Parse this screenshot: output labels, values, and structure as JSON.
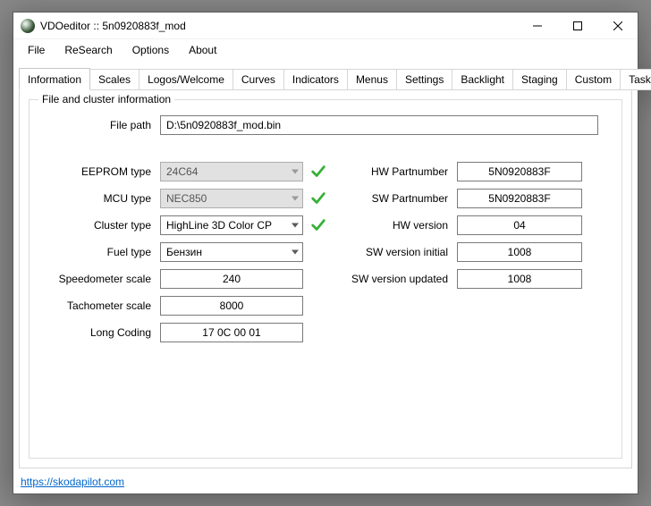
{
  "window": {
    "title": "VDOeditor :: 5n0920883f_mod"
  },
  "menu": {
    "file": "File",
    "research": "ReSearch",
    "options": "Options",
    "about": "About"
  },
  "tabs": {
    "information": "Information",
    "scales": "Scales",
    "logos": "Logos/Welcome",
    "curves": "Curves",
    "indicators": "Indicators",
    "menus": "Menus",
    "settings": "Settings",
    "backlight": "Backlight",
    "staging": "Staging",
    "custom": "Custom",
    "tasks": "Tasks"
  },
  "fieldset_legend": "File and cluster information",
  "labels": {
    "file_path": "File path",
    "eeprom_type": "EEPROM type",
    "mcu_type": "MCU type",
    "cluster_type": "Cluster type",
    "fuel_type": "Fuel type",
    "speedometer_scale": "Speedometer scale",
    "tachometer_scale": "Tachometer scale",
    "long_coding": "Long Coding",
    "hw_partnumber": "HW Partnumber",
    "sw_partnumber": "SW Partnumber",
    "hw_version": "HW version",
    "sw_version_initial": "SW version initial",
    "sw_version_updated": "SW version updated"
  },
  "values": {
    "file_path": "D:\\5n0920883f_mod.bin",
    "eeprom_type": "24C64",
    "mcu_type": "NEC850",
    "cluster_type": "HighLine 3D Color CP",
    "fuel_type": "Бензин",
    "speedometer_scale": "240",
    "tachometer_scale": "8000",
    "long_coding": "17 0C 00 01",
    "hw_partnumber": "5N0920883F",
    "sw_partnumber": "5N0920883F",
    "hw_version": "04",
    "sw_version_initial": "1008",
    "sw_version_updated": "1008"
  },
  "footer": {
    "link": "https://skodapilot.com"
  }
}
